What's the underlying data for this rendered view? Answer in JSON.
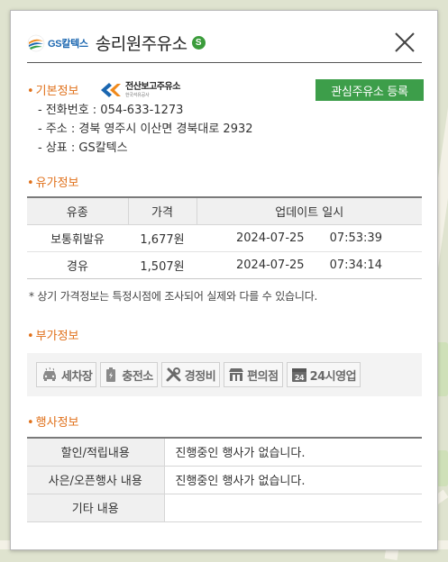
{
  "header": {
    "brand_text": "GS칼텍스",
    "station_name": "송리원주유소",
    "self_badge": "S"
  },
  "basic": {
    "section_title": "기본정보",
    "cert_logo_main": "전산보고주유소",
    "cert_logo_sub": "한국석유공사",
    "favorite_button": "관심주유소 등록",
    "phone": "- 전화번호 : 054-633-1273",
    "address": "- 주소 : 경북 영주시 이산면 경북대로 2932",
    "brand": "- 상표 : GS칼텍스"
  },
  "price": {
    "section_title": "유가정보",
    "columns": [
      "유종",
      "가격",
      "업데이트 일시"
    ],
    "rows": [
      {
        "fuel": "보통휘발유",
        "price": "1,677원",
        "date": "2024-07-25",
        "time": "07:53:39"
      },
      {
        "fuel": "경유",
        "price": "1,507원",
        "date": "2024-07-25",
        "time": "07:34:14"
      }
    ],
    "notice": "* 상기 가격정보는 특정시점에 조사되어 실제와 다를 수 있습니다."
  },
  "amenities": {
    "section_title": "부가정보",
    "items": [
      {
        "label": "세차장",
        "icon": "car-wash-icon"
      },
      {
        "label": "충전소",
        "icon": "charging-station-icon"
      },
      {
        "label": "경정비",
        "icon": "wrench-icon"
      },
      {
        "label": "편의점",
        "icon": "store-icon"
      },
      {
        "label": "24시영업",
        "icon": "24h-icon"
      }
    ]
  },
  "events": {
    "section_title": "행사정보",
    "rows": [
      {
        "label": "할인/적립내용",
        "value": "진행중인 행사가 없습니다."
      },
      {
        "label": "사은/오픈행사 내용",
        "value": "진행중인 행사가 없습니다."
      },
      {
        "label": "기타 내용",
        "value": ""
      }
    ]
  },
  "colors": {
    "accent_orange": "#e0701a",
    "favorite_green": "#3d9e4a",
    "brand_blue": "#1a66b0"
  }
}
